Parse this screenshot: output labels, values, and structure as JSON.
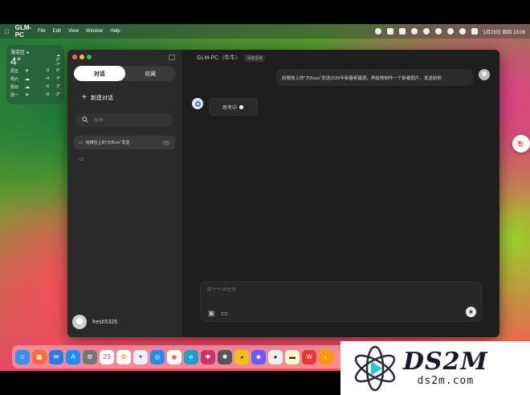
{
  "menubar": {
    "app_name": "GLM-PC",
    "menus": [
      "File",
      "Edit",
      "View",
      "Window",
      "Help"
    ],
    "clock": "1月23日 周四  13:06"
  },
  "weather": {
    "city": "海淀区 ◂",
    "temp": "4°",
    "high": "5°",
    "low": "-7°",
    "forecast": [
      {
        "day": "周五",
        "icon": "sun-icon",
        "lo": "-3",
        "hi": "6°"
      },
      {
        "day": "周六",
        "icon": "cloud-icon",
        "lo": "-4",
        "hi": "4°"
      },
      {
        "day": "周日",
        "icon": "cloud-icon",
        "lo": "-5",
        "hi": "3°"
      },
      {
        "day": "周一",
        "icon": "sun-icon",
        "lo": "-8",
        "hi": "-2°"
      }
    ]
  },
  "sidebar": {
    "tabs": [
      {
        "label": "对话",
        "active": true
      },
      {
        "label": "收藏",
        "active": false
      }
    ],
    "new_chat": "新建对话",
    "search_placeholder": "搜索",
    "conversation": "给微信上的\"大Boss\"发送",
    "user_name": "fresh5326"
  },
  "chat": {
    "title": "GLM-PC（牛牛）",
    "badge": "深度思考",
    "user_message": "给微信上的\"大Boss\"发送2025年新春祝福语，再给他制作一个新春图片，发送给他",
    "thinking": "思考中",
    "composer_placeholder": "给牛牛派任务"
  },
  "colors": {
    "window_bg": "#1e1e1e",
    "sidebar_bg": "#2a2a2a",
    "close": "#ff5f57",
    "minimize": "#febc2e",
    "zoom": "#28c840"
  },
  "watermark": {
    "big": "DS2M",
    "small": "ds2m.com"
  }
}
